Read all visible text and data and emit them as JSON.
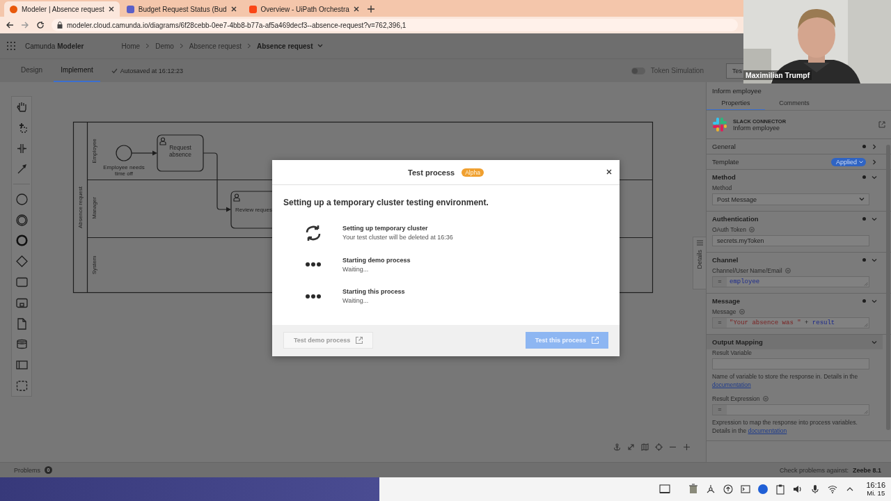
{
  "browser": {
    "tabs": [
      {
        "title": "Modeler | Absence request",
        "selected": true,
        "color": "#e8590c"
      },
      {
        "title": "Budget Request Status (Bud",
        "selected": false,
        "color": "#5b5fc7"
      },
      {
        "title": "Overview - UiPath Orchestra",
        "selected": false,
        "color": "#fa4616"
      }
    ],
    "url": "modeler.cloud.camunda.io/diagrams/6f28cebb-0ee7-4bb8-b77a-af5a469decf3--absence-request?v=762,396,1"
  },
  "app": {
    "brand": "Camunda **Modeler**",
    "breadcrumbs": [
      "Home",
      "Demo",
      "Absence request",
      "Absence request"
    ]
  },
  "mode_tabs": [
    {
      "label": "Design",
      "selected": false
    },
    {
      "label": "Implement",
      "selected": true
    }
  ],
  "autosave": "Autosaved at 16:12:23",
  "token_simulation": {
    "label": "Token Simulation",
    "on": false
  },
  "test_button": "Tes",
  "video": {
    "caption": "Maximilian Trumpf"
  },
  "diagram": {
    "pool": "Absence request",
    "lanes": [
      "Employee",
      "Manager",
      "System"
    ],
    "start_event": "Employee needs time off",
    "tasks": [
      "Request absence",
      "Review reques"
    ]
  },
  "details_tab": "Details",
  "properties": {
    "title": "Inform employee",
    "tabs": [
      {
        "label": "Properties",
        "selected": true
      },
      {
        "label": "Comments",
        "selected": false
      }
    ],
    "connector": {
      "type": "SLACK CONNECTOR",
      "name": "Inform employee"
    },
    "sections": [
      {
        "title": "General",
        "expanded": false,
        "dot": true
      },
      {
        "title": "Template",
        "expanded": false,
        "dot": false,
        "badge": "Applied"
      },
      {
        "title": "Method",
        "expanded": true,
        "dot": true,
        "fields": [
          {
            "kind": "select",
            "label": "Method",
            "value": "Post Message"
          }
        ]
      },
      {
        "title": "Authentication",
        "expanded": true,
        "dot": true,
        "fields": [
          {
            "kind": "text",
            "label": "OAuth Token",
            "info": true,
            "value": "secrets.myToken"
          }
        ]
      },
      {
        "title": "Channel",
        "expanded": true,
        "dot": true,
        "fields": [
          {
            "kind": "feel",
            "label": "Channel/User Name/Email",
            "info": true,
            "prefix": "=",
            "tokens": [
              {
                "kind": "name",
                "text": "employee"
              }
            ]
          }
        ]
      },
      {
        "title": "Message",
        "expanded": true,
        "dot": true,
        "fields": [
          {
            "kind": "feel",
            "label": "Message",
            "info": true,
            "prefix": "=",
            "tokens": [
              {
                "kind": "string",
                "text": "\"Your absence was \""
              },
              {
                "kind": "op",
                "text": "+"
              },
              {
                "kind": "name",
                "text": "result"
              }
            ]
          }
        ]
      },
      {
        "title": "Output Mapping",
        "expanded": true,
        "dot": false,
        "fields": [
          {
            "kind": "text",
            "label": "Result Variable",
            "info": false,
            "hint": "Name of variable to store the response in. Details in the",
            "link": "documentation"
          },
          {
            "kind": "feel",
            "label": "Result Expression",
            "info": true,
            "prefix": "=",
            "hint": "Expression to map the response into process variables. Details in the",
            "link": "documentation"
          }
        ]
      }
    ]
  },
  "modal": {
    "title": "Test process",
    "badge": "Alpha",
    "heading": "Setting up a temporary cluster testing environment.",
    "steps": [
      {
        "kind": "running",
        "title": "Setting up temporary cluster",
        "detail": "Your test cluster will be deleted at 16:36"
      },
      {
        "kind": "pending",
        "title": "Starting demo process",
        "detail": "Waiting..."
      },
      {
        "kind": "pending",
        "title": "Starting this process",
        "detail": "Waiting..."
      }
    ],
    "buttons": [
      {
        "kind": "secondary",
        "label": "Test demo process",
        "disabled": true
      },
      {
        "kind": "primary",
        "label": "Test this process",
        "disabled": true
      }
    ]
  },
  "problems": {
    "label": "Problems",
    "count": "0",
    "check_label": "Check problems against:",
    "engine": "Zeebe 8.1"
  },
  "taskbar": {
    "time": "16:16",
    "date": "Mi. 15"
  }
}
